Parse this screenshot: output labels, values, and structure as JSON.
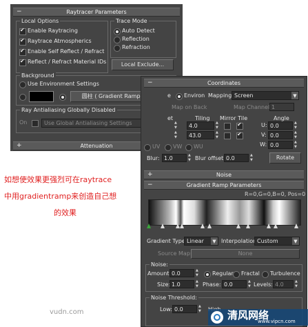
{
  "colors": {
    "panel": "#444444",
    "rollout": "#5a5a5a",
    "annotation": "#e02020",
    "watermark_bg": "#1a5a8a"
  },
  "raytracer": {
    "title": "Raytracer Parameters",
    "local_options": {
      "label": "Local Options",
      "items": [
        {
          "label": "Enable Raytracing",
          "checked": true
        },
        {
          "label": "Raytrace Atmospherics",
          "checked": true
        },
        {
          "label": "Enable Self Reflect / Refract",
          "checked": true
        },
        {
          "label": "Reflect / Refract Material IDs",
          "checked": true
        }
      ]
    },
    "trace_mode": {
      "label": "Trace Mode",
      "options": [
        {
          "label": "Auto Detect",
          "selected": true
        },
        {
          "label": "Reflection",
          "selected": false
        },
        {
          "label": "Refraction",
          "selected": false
        }
      ]
    },
    "local_exclude": "Local Exclude...",
    "background": {
      "label": "Background",
      "use_env": "Use Environment Settings",
      "map_button": "圆柱 ( Gradient Ramp )"
    },
    "antialias": {
      "label": "Ray Antialiasing Globally Disabled",
      "on_label": "On",
      "dropdown": "Use Global Antialiasing Settings"
    },
    "attenuation": "Attenuation"
  },
  "coordinates": {
    "title": "Coordinates",
    "texture_partial": "e",
    "environ": "Environ",
    "mapping_label": "Mapping:",
    "mapping_value": "Screen",
    "map_on_back": "Map on Back",
    "map_channel_label": "Map Channel:",
    "map_channel_value": "1",
    "offset_label": "et",
    "tiling_label": "Tiling",
    "mirror_tile_label": "Mirror Tile",
    "angle_label": "Angle",
    "tiling_values": [
      "4.0",
      "43.0"
    ],
    "u_label": "U:",
    "v_label": "V:",
    "w_label": "W:",
    "angles": [
      "0.0",
      "0.0",
      "0.0"
    ],
    "uv_label": "UV",
    "vw_label": "VW",
    "wu_label": "WU",
    "blur_label": "Blur:",
    "blur_value": "1.0",
    "blur_offset_label": "Blur offset:",
    "blur_offset_value": "0.0",
    "rotate": "Rotate"
  },
  "noise_rollout": "Noise",
  "gradient": {
    "title": "Gradient Ramp Parameters",
    "rgb_readout": "R=0,G=0,B=0, Pos=0",
    "gradient_type_label": "Gradient Type:",
    "gradient_type_value": "Linear",
    "interpolation_label": "Interpolation:",
    "interpolation_value": "Custom",
    "source_map_label": "Source Map:",
    "source_map_value": "None",
    "noise_label": "Noise:",
    "amount_label": "Amount:",
    "amount_value": "0.0",
    "regular": "Regular",
    "fractal": "Fractal",
    "turbulence": "Turbulence",
    "size_label": "Size:",
    "size_value": "1.0",
    "phase_label": "Phase:",
    "phase_value": "0.0",
    "levels_label": "Levels:",
    "levels_value": "4.0",
    "threshold_label": "Noise Threshold:",
    "low_label": "Low:",
    "low_value": "0.0",
    "high_partial": "High"
  },
  "annotation": {
    "line1": "如想使效果更强烈可在raytrace",
    "line2": "中用gradientramp来创造自己想",
    "line3": "的效果"
  },
  "watermark": {
    "site": "vudn.com",
    "brand": "清风网络",
    "url": "www.vipcn.com"
  }
}
